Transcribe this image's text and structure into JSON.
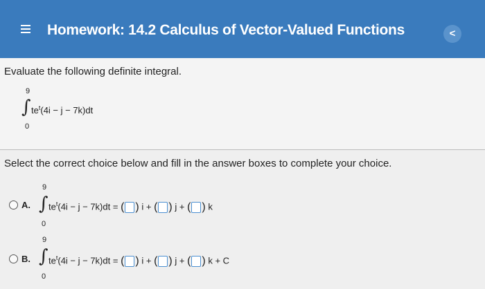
{
  "header": {
    "title": "Homework: 14.2 Calculus of Vector-Valued Functions",
    "menu_icon": "hamburger-menu-icon",
    "back_icon": "chevron-left-icon",
    "back_glyph": "<"
  },
  "question": {
    "prompt": "Evaluate the following definite integral.",
    "upper": "9",
    "lower": "0",
    "integrand_base": "te",
    "integrand_exp": "t",
    "integrand_vector": "(4i − j − 7k)dt"
  },
  "instructions": "Select the correct choice below and fill in the answer boxes to complete your choice.",
  "options": [
    {
      "label": "A.",
      "upper": "9",
      "lower": "0",
      "lhs_base": "te",
      "lhs_exp": "t",
      "lhs_vector": "(4i − j − 7k)dt =",
      "unit_i": "i +",
      "unit_j": "j +",
      "unit_k": "k"
    },
    {
      "label": "B.",
      "upper": "9",
      "lower": "0",
      "lhs_base": "te",
      "lhs_exp": "t",
      "lhs_vector": "(4i − j − 7k)dt =",
      "unit_i": "i +",
      "unit_j": "j +",
      "unit_k": "k + C"
    }
  ]
}
